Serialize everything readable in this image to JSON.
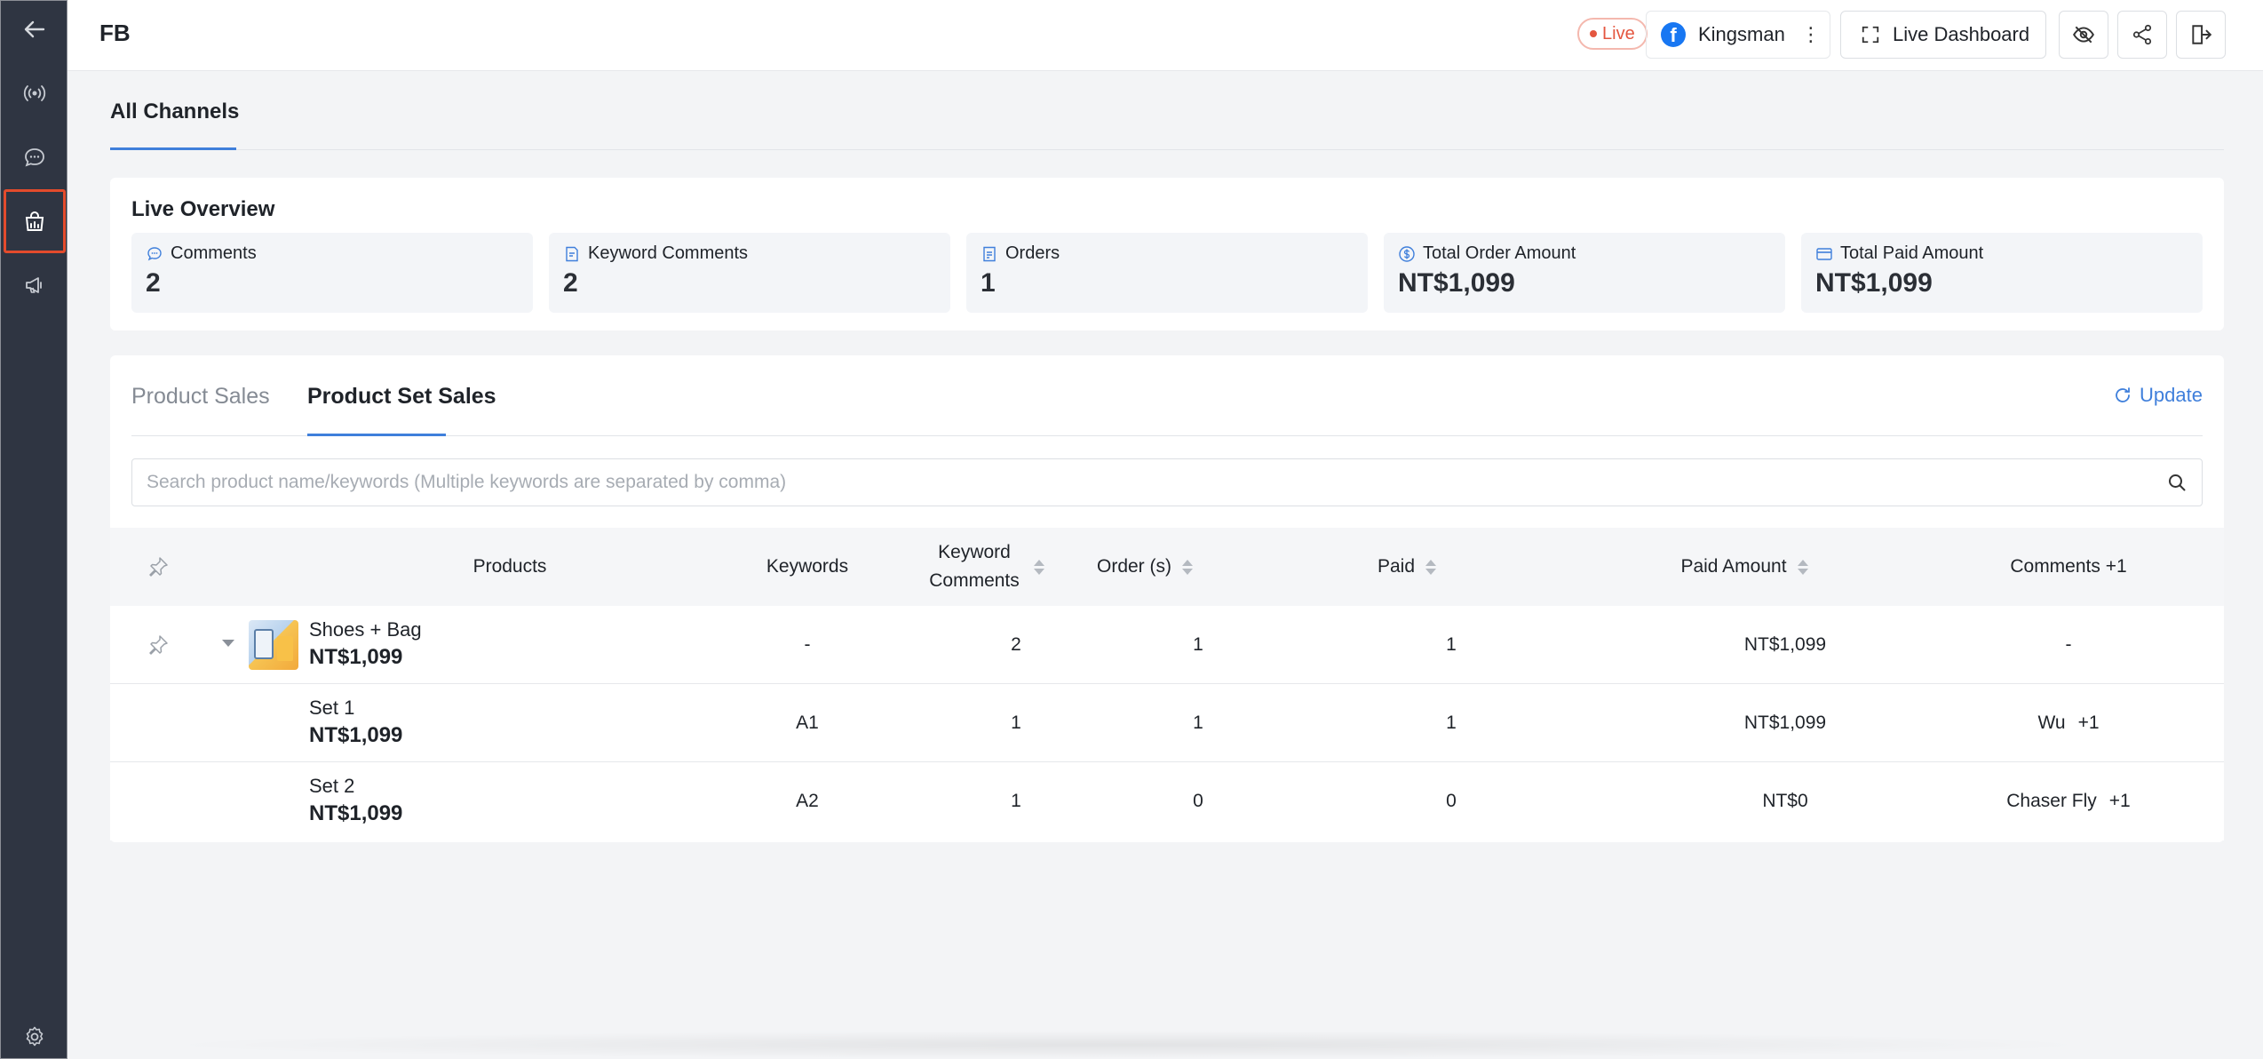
{
  "colors": {
    "accent": "#3f7fdb",
    "sidebar": "#2f3542",
    "live": "#e4563f",
    "active_outline": "#e44b2c"
  },
  "sidebar": {
    "items": [
      {
        "icon": "arrow-left-icon"
      },
      {
        "icon": "broadcast-icon"
      },
      {
        "icon": "chat-icon"
      },
      {
        "icon": "shopping-bag-chart-icon",
        "active": true
      },
      {
        "icon": "megaphone-icon"
      },
      {
        "icon": "gear-icon"
      }
    ]
  },
  "header": {
    "title": "FB",
    "live_label": "Live",
    "account_name": "Kingsman",
    "dashboard_label": "Live Dashboard",
    "icons": [
      "eye-off-icon",
      "share-icon",
      "exit-icon"
    ]
  },
  "channel_tab": {
    "label": "All Channels"
  },
  "overview": {
    "title": "Live Overview",
    "stats": [
      {
        "icon": "comment-icon",
        "label": "Comments",
        "value": "2"
      },
      {
        "icon": "keyword-doc-icon",
        "label": "Keyword Comments",
        "value": "2"
      },
      {
        "icon": "order-doc-icon",
        "label": "Orders",
        "value": "1"
      },
      {
        "icon": "dollar-circle-icon",
        "label": "Total Order Amount",
        "value": "NT$1,099"
      },
      {
        "icon": "card-icon",
        "label": "Total Paid Amount",
        "value": "NT$1,099"
      }
    ]
  },
  "sales": {
    "tabs": [
      {
        "label": "Product Sales",
        "active": false
      },
      {
        "label": "Product Set Sales",
        "active": true
      }
    ],
    "update_label": "Update",
    "search_placeholder": "Search product name/keywords (Multiple keywords are separated by comma)",
    "columns": {
      "products": "Products",
      "keywords": "Keywords",
      "keyword_comments": "Keyword Comments",
      "orders": "Order (s)",
      "paid": "Paid",
      "paid_amount": "Paid Amount",
      "comments": "Comments +1"
    },
    "rows": [
      {
        "name": "Shoes + Bag",
        "price": "NT$1,099",
        "keywords": "-",
        "keyword_comments": "2",
        "orders": "1",
        "paid": "1",
        "paid_amount": "NT$1,099",
        "commenter": "-",
        "commenter_extra": ""
      },
      {
        "name": "Set 1",
        "price": "NT$1,099",
        "keywords": "A1",
        "keyword_comments": "1",
        "orders": "1",
        "paid": "1",
        "paid_amount": "NT$1,099",
        "commenter": "Wu",
        "commenter_extra": "+1"
      },
      {
        "name": "Set 2",
        "price": "NT$1,099",
        "keywords": "A2",
        "keyword_comments": "1",
        "orders": "0",
        "paid": "0",
        "paid_amount": "NT$0",
        "commenter": "Chaser Fly",
        "commenter_extra": "+1"
      }
    ]
  }
}
